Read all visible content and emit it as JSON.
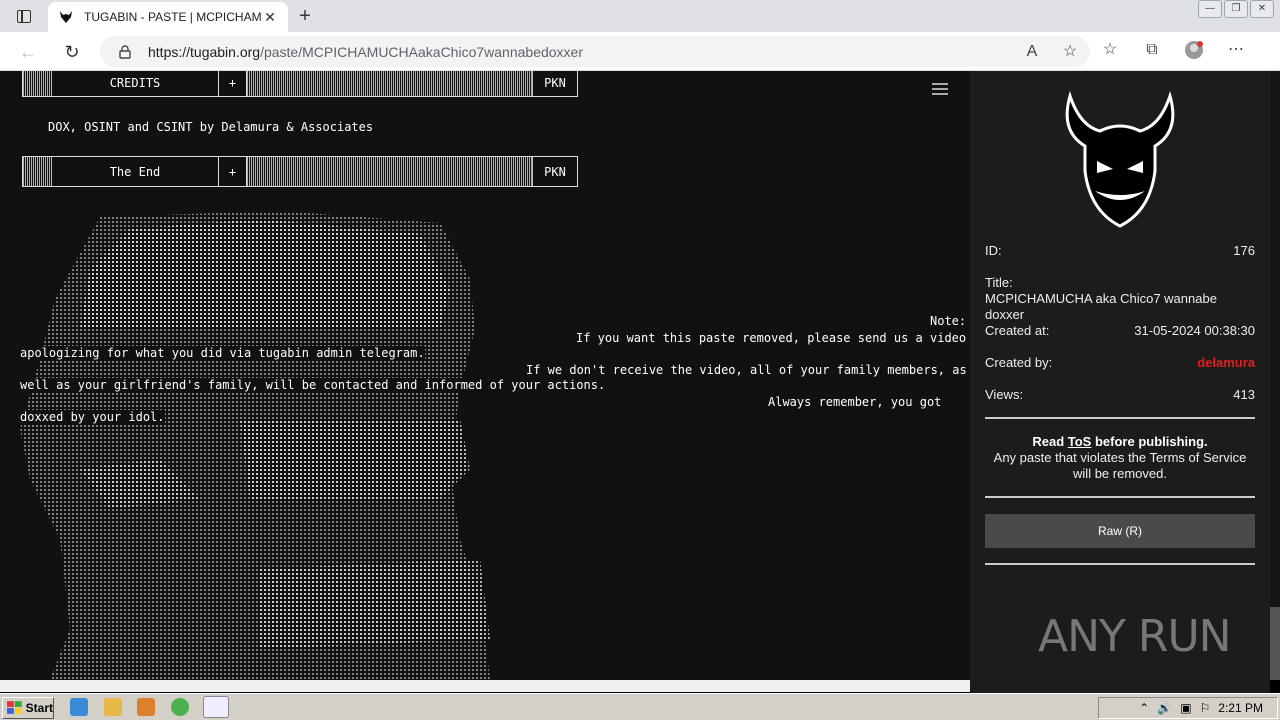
{
  "browser": {
    "tab_title": "TUGABIN - PASTE | MCPICHAMU",
    "tab_close": "✕",
    "new_tab": "+",
    "url_host": "https://tugabin.org",
    "url_path": "/paste/MCPICHAMUCHAakaChico7wannabedoxxer",
    "win_min": "—",
    "win_max": "❐",
    "win_close": "✕"
  },
  "paste": {
    "credits_label": "CREDITS",
    "plus": "+",
    "pkn": "PKN",
    "credits_text": "DOX, OSINT and CSINT by Delamura & Associates",
    "end_label": "The End",
    "note_label": "Note:",
    "note_line1": "If you want this paste removed, please send us a video",
    "note_line2": "apologizing for what you did via tugabin admin telegram.",
    "note_line3": "If we don't receive the video, all of your family members, as",
    "note_line4": "well as your girlfriend's family, will be contacted and informed of your actions.",
    "note_line5": "Always remember, you got",
    "note_line6": "doxxed by your idol."
  },
  "sidebar": {
    "id_label": "ID:",
    "id_value": "176",
    "title_label": "Title:",
    "title_value_1": "MCPICHAMUCHA aka Chico7 wannabe",
    "title_value_2": "doxxer",
    "created_at_label": "Created at:",
    "created_at_value": "31-05-2024 00:38:30",
    "created_by_label": "Created by:",
    "created_by_value": "delamura",
    "views_label": "Views:",
    "views_value": "413",
    "tos_read": "Read",
    "tos_link": "ToS",
    "tos_before": "before publishing.",
    "tos_line2": "Any paste that violates the Terms of Service",
    "tos_line3": "will be removed.",
    "raw_button": "Raw (R)",
    "watermark": "ANY RUN"
  },
  "taskbar": {
    "start_label": "Start",
    "clock": "2:21 PM"
  },
  "colors": {
    "creator_red": "#e0201a",
    "page_bg": "#111111",
    "sidebar_bg": "#1c1c1c"
  }
}
